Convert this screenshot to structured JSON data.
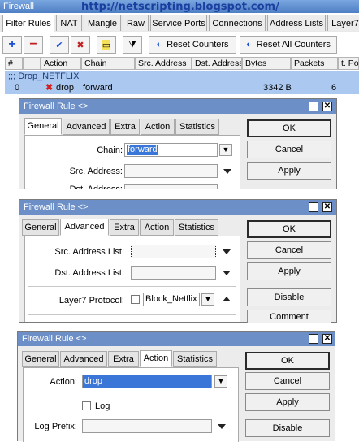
{
  "main": {
    "title": "Firewall",
    "watermark": "http://netscripting.blogspot.com/",
    "tabs": [
      "Filter Rules",
      "NAT",
      "Mangle",
      "Raw",
      "Service Ports",
      "Connections",
      "Address Lists",
      "Layer7"
    ],
    "toolbar": {
      "add": "+",
      "remove": "−",
      "enable": "✔",
      "disable": "✖",
      "comment": "▭",
      "filter": "⧩",
      "reset_counters": "Reset Counters",
      "reset_all_counters": "Reset All Counters"
    },
    "columns": [
      "#",
      "Action",
      "Chain",
      "Src. Address",
      "Dst. Address",
      "Bytes",
      "Packets",
      "t. Po"
    ],
    "comment_row": ";;; Drop_NETFLIX",
    "row": {
      "num": "0",
      "action": "drop",
      "chain": "forward",
      "bytes": "3342 B",
      "packets": "6"
    }
  },
  "dialog1": {
    "title": "Firewall Rule <>",
    "tabs": [
      "General",
      "Advanced",
      "Extra",
      "Action",
      "Statistics"
    ],
    "chain_label": "Chain:",
    "chain_value": "forward",
    "src_label": "Src. Address:",
    "dst_label": "Dst. Address:",
    "ok": "OK",
    "cancel": "Cancel",
    "apply": "Apply"
  },
  "dialog2": {
    "title": "Firewall Rule <>",
    "tabs": [
      "General",
      "Advanced",
      "Extra",
      "Action",
      "Statistics"
    ],
    "src_list_label": "Src. Address List:",
    "dst_list_label": "Dst. Address List:",
    "l7_label": "Layer7 Protocol:",
    "l7_value": "Block_Netflix",
    "ok": "OK",
    "cancel": "Cancel",
    "apply": "Apply",
    "disable": "Disable",
    "comment": "Comment"
  },
  "dialog3": {
    "title": "Firewall Rule <>",
    "tabs": [
      "General",
      "Advanced",
      "Extra",
      "Action",
      "Statistics"
    ],
    "action_label": "Action:",
    "action_value": "drop",
    "log_label": "Log",
    "log_prefix_label": "Log Prefix:",
    "ok": "OK",
    "cancel": "Cancel",
    "apply": "Apply",
    "disable": "Disable"
  },
  "colors": {
    "selection": "#3a76d8",
    "title_bar": "#6c8fc7",
    "row_highlight": "#aac8f0"
  }
}
